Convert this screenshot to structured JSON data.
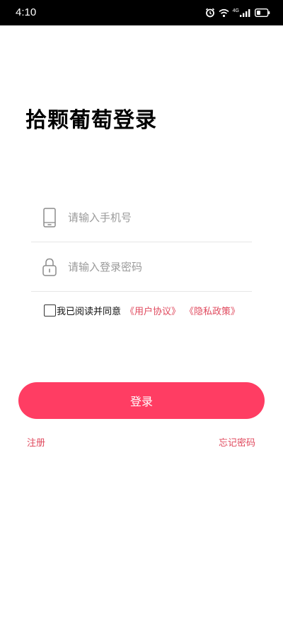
{
  "status_bar": {
    "time": "4:10",
    "network_label": "4G",
    "icons": [
      "alarm-icon",
      "wifi-icon",
      "signal-icon",
      "battery-icon"
    ]
  },
  "title": "拾颗葡萄登录",
  "phone_field": {
    "placeholder": "请输入手机号",
    "value": "",
    "icon": "phone-icon"
  },
  "password_field": {
    "placeholder": "请输入登录密码",
    "value": "",
    "icon": "lock-icon"
  },
  "agreement": {
    "checked": false,
    "text": "我已阅读并同意",
    "user_agreement": "《用户协议》",
    "privacy_policy": "《隐私政策》"
  },
  "login_button_label": "登录",
  "register_label": "注册",
  "forgot_password_label": "忘记密码",
  "colors": {
    "accent": "#ff3d63",
    "link": "#e04a5e",
    "placeholder": "#9a9a9a",
    "divider": "#e6e6e6"
  }
}
